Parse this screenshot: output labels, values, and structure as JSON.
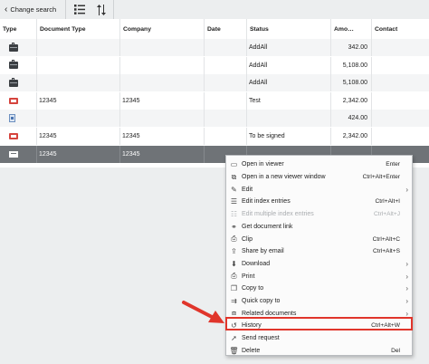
{
  "toolbar": {
    "back_label": "Change search",
    "back_icon": "chevron-left-icon",
    "list_icon": "list-view-icon",
    "sort_icon": "sort-icon"
  },
  "columns": [
    "Type",
    "Document Type",
    "Company",
    "Date",
    "Status",
    "Amo…",
    "Contact"
  ],
  "rows": [
    {
      "icon": "briefcase-icon",
      "doc_type": "",
      "company": "",
      "date": "",
      "status": "AddAll",
      "amount": "342.00",
      "contact": ""
    },
    {
      "icon": "briefcase-icon",
      "doc_type": "",
      "company": "",
      "date": "",
      "status": "AddAll",
      "amount": "5,108.00",
      "contact": ""
    },
    {
      "icon": "briefcase-icon",
      "doc_type": "",
      "company": "",
      "date": "",
      "status": "AddAll",
      "amount": "5,108.00",
      "contact": ""
    },
    {
      "icon": "pdf-icon",
      "doc_type": "12345",
      "company": "12345",
      "date": "",
      "status": "Test",
      "amount": "2,342.00",
      "contact": ""
    },
    {
      "icon": "document-icon",
      "doc_type": "",
      "company": "",
      "date": "",
      "status": "",
      "amount": "424.00",
      "contact": ""
    },
    {
      "icon": "pdf-icon",
      "doc_type": "12345",
      "company": "12345",
      "date": "",
      "status": "To be signed",
      "amount": "2,342.00",
      "contact": ""
    },
    {
      "icon": "email-icon",
      "doc_type": "12345",
      "company": "12345",
      "date": "",
      "status": "",
      "amount": "",
      "contact": ""
    }
  ],
  "selected_row": 6,
  "context_menu": {
    "items": [
      {
        "label": "Open in viewer",
        "shortcut": "Enter",
        "icon": "viewer-icon",
        "submenu": false,
        "disabled": false
      },
      {
        "label": "Open in a new viewer window",
        "shortcut": "Ctrl+Alt+Enter",
        "icon": "new-window-icon",
        "submenu": false,
        "disabled": false
      },
      {
        "label": "Edit",
        "shortcut": "",
        "icon": "pencil-icon",
        "submenu": true,
        "disabled": false
      },
      {
        "label": "Edit index entries",
        "shortcut": "Ctrl+Alt+I",
        "icon": "edit-index-icon",
        "submenu": false,
        "disabled": false
      },
      {
        "label": "Edit multiple index entries",
        "shortcut": "Ctrl+Alt+J",
        "icon": "edit-multiple-icon",
        "submenu": false,
        "disabled": true
      },
      {
        "label": "Get document link",
        "shortcut": "",
        "icon": "link-icon",
        "submenu": false,
        "disabled": false
      },
      {
        "label": "Clip",
        "shortcut": "Ctrl+Alt+C",
        "icon": "paperclip-icon",
        "submenu": false,
        "disabled": false
      },
      {
        "label": "Share by email",
        "shortcut": "Ctrl+Alt+S",
        "icon": "share-icon",
        "submenu": false,
        "disabled": false
      },
      {
        "label": "Download",
        "shortcut": "",
        "icon": "download-icon",
        "submenu": true,
        "disabled": false
      },
      {
        "label": "Print",
        "shortcut": "",
        "icon": "printer-icon",
        "submenu": true,
        "disabled": false
      },
      {
        "label": "Copy to",
        "shortcut": "",
        "icon": "copy-icon",
        "submenu": true,
        "disabled": false
      },
      {
        "label": "Quick copy to",
        "shortcut": "",
        "icon": "quick-copy-icon",
        "submenu": true,
        "disabled": false
      },
      {
        "label": "Related documents",
        "shortcut": "",
        "icon": "related-documents-icon",
        "submenu": true,
        "disabled": false
      },
      {
        "label": "History",
        "shortcut": "Ctrl+Alt+W",
        "icon": "history-icon",
        "submenu": false,
        "disabled": false
      },
      {
        "label": "Send request",
        "shortcut": "",
        "icon": "send-request-icon",
        "submenu": false,
        "disabled": false
      },
      {
        "label": "Delete",
        "shortcut": "Del",
        "icon": "trash-icon",
        "submenu": false,
        "disabled": false
      }
    ],
    "highlighted_item": "History"
  },
  "colors": {
    "highlight_border": "#e0352b",
    "arrow": "#e0352b",
    "selected_row": "#6f7377"
  }
}
